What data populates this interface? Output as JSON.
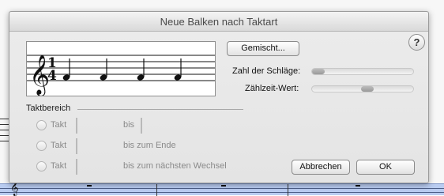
{
  "dialog": {
    "title": "Neue Balken nach Taktart",
    "help_label": "?",
    "preview": {
      "clef_glyph": "𝄞",
      "time_signature_top": "1",
      "time_signature_bottom": "4",
      "beat_notes": 4
    },
    "mixed_button_label": "Gemischt...",
    "beats_label": "Zahl der Schläge:",
    "beats_slider_value": 0.0,
    "beat_value_label": "Zählzeit-Wert:",
    "beat_value_slider_value": 0.55,
    "measure_range": {
      "title": "Taktbereich",
      "rows": [
        {
          "radio_label": "Takt",
          "mid_label": "bis",
          "has_second_field": true,
          "from_value": "",
          "to_value": ""
        },
        {
          "radio_label": "Takt",
          "mid_label": "bis zum Ende",
          "has_second_field": false,
          "from_value": ""
        },
        {
          "radio_label": "Takt",
          "mid_label": "bis zum nächsten Wechsel",
          "has_second_field": false,
          "from_value": ""
        }
      ]
    },
    "cancel_label": "Abbrechen",
    "ok_label": "OK"
  },
  "background_score": {
    "clef_glyph": "𝄞"
  }
}
